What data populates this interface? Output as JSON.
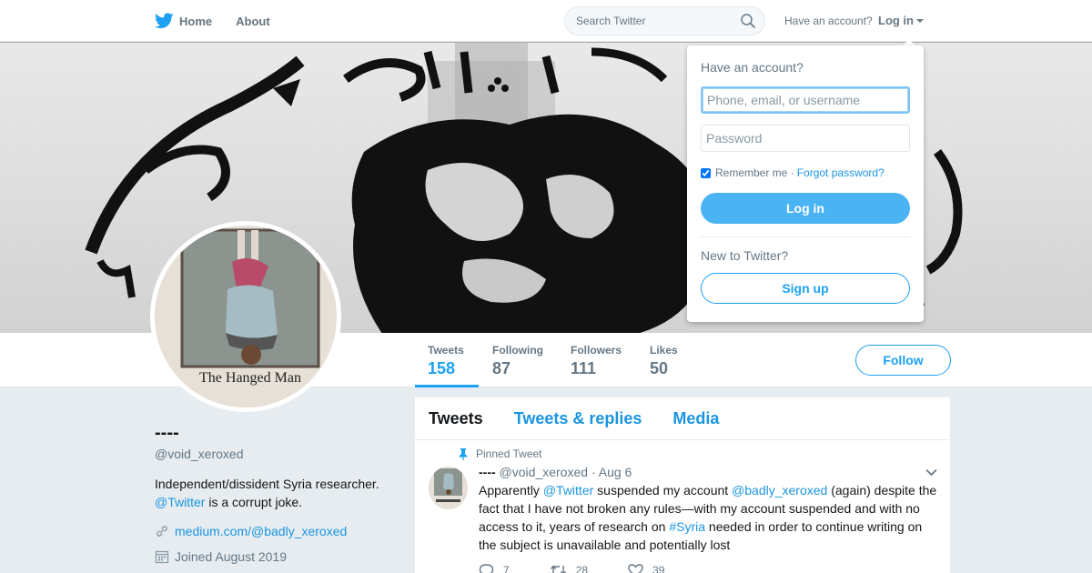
{
  "colors": {
    "brand": "#1da1f2",
    "link": "#1b95e0",
    "muted": "#657786",
    "background": "#e6ecf0"
  },
  "nav": {
    "home_label": "Home",
    "about_label": "About",
    "search_placeholder": "Search Twitter",
    "account_prompt": "Have an account?",
    "login_label": "Log in",
    "icons": [
      "twitter-bird-icon",
      "search-icon",
      "chevron-down-icon"
    ]
  },
  "login_dropdown": {
    "title": "Have an account?",
    "username_placeholder": "Phone, email, or username",
    "username_value": "",
    "password_placeholder": "Password",
    "remember_label": "Remember me",
    "remember_checked": true,
    "separator": "·",
    "forgot_label": "Forgot password?",
    "login_button": "Log in",
    "new_prompt": "New to Twitter?",
    "signup_button": "Sign up"
  },
  "profile": {
    "name": "----",
    "handle": "@void_xeroxed",
    "bio_text": "Independent/dissident Syria researcher.",
    "bio_mention": "@Twitter",
    "bio_suffix": " is a corrupt joke.",
    "url": "medium.com/@badly_xeroxed",
    "joined": "Joined August 2019",
    "avatar_caption": "The Hanged Man"
  },
  "stats": [
    {
      "label": "Tweets",
      "value": "158",
      "active": true
    },
    {
      "label": "Following",
      "value": "87",
      "active": false
    },
    {
      "label": "Followers",
      "value": "111",
      "active": false
    },
    {
      "label": "Likes",
      "value": "50",
      "active": false
    }
  ],
  "follow_button": "Follow",
  "timeline": {
    "tabs": [
      {
        "label": "Tweets",
        "active": true
      },
      {
        "label": "Tweets & replies",
        "active": false
      },
      {
        "label": "Media",
        "active": false
      }
    ],
    "pinned_label": "Pinned Tweet",
    "tweet": {
      "name": "----",
      "handle": "@void_xeroxed",
      "separator": "·",
      "date": "Aug 6",
      "text_1": "Apparently ",
      "mention_1": "@Twitter",
      "text_2": " suspended my account ",
      "mention_2": "@badly_xeroxed",
      "text_3": " (again) despite the fact that I have not broken any rules—with my account suspended and with no access to it, years of research on ",
      "hashtag": "#Syria",
      "text_4": " needed in order to continue writing on the subject is unavailable and potentially lost",
      "replies": "7",
      "retweets": "28",
      "likes": "39"
    }
  }
}
